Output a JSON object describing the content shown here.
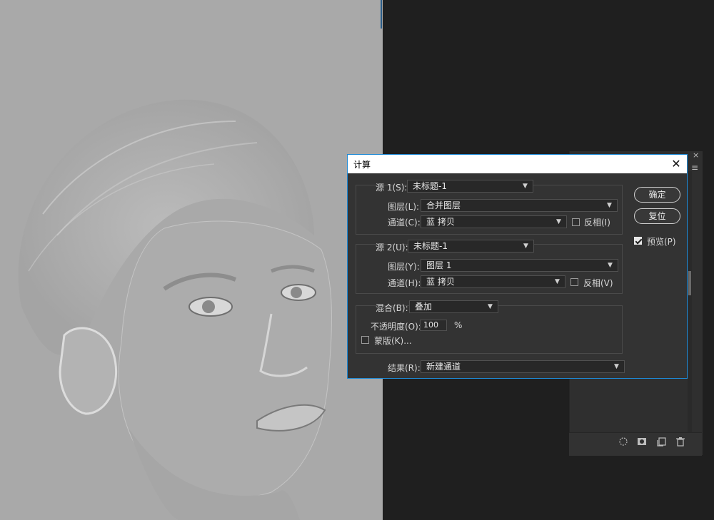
{
  "dialog": {
    "title": "计算",
    "close_glyph": "✕",
    "source1": {
      "label": "源 1(S):",
      "file": "未标题-1",
      "layer_label": "图层(L):",
      "layer": "合并图层",
      "channel_label": "通道(C):",
      "channel": "蓝 拷贝",
      "invert_label": "反相(I)",
      "invert_checked": false
    },
    "source2": {
      "label": "源 2(U):",
      "file": "未标题-1",
      "layer_label": "图层(Y):",
      "layer": "图层 1",
      "channel_label": "通道(H):",
      "channel": "蓝 拷贝",
      "invert_label": "反相(V)",
      "invert_checked": false
    },
    "blend": {
      "label": "混合(B):",
      "mode": "叠加",
      "opacity_label": "不透明度(O):",
      "opacity": "100",
      "opacity_unit": "%",
      "mask_label": "蒙版(K)...",
      "mask_checked": false
    },
    "result": {
      "label": "结果(R):",
      "value": "新建通道"
    },
    "buttons": {
      "ok": "确定",
      "reset": "复位"
    },
    "preview": {
      "label": "预览(P)",
      "checked": true
    }
  },
  "panel": {
    "close_glyph": "×",
    "menu_glyph": "≡",
    "icons": [
      "selection-icon",
      "mask-icon",
      "new-channel-icon",
      "trash-icon"
    ]
  }
}
